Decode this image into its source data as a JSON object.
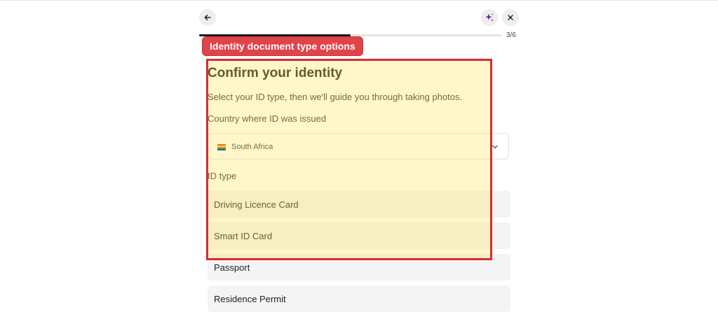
{
  "header": {
    "back_icon": "arrow-left-icon",
    "ai_icon": "sparkle-icon",
    "close_icon": "close-icon",
    "progress_text": "3/6",
    "progress_fraction": 0.5
  },
  "page": {
    "title": "Confirm your identity",
    "subtitle": "Select your ID type, then we'll guide you through taking photos.",
    "country_label": "Country where ID was issued",
    "country_value": "South Africa",
    "id_type_label": "ID type",
    "id_options": [
      "Driving Licence Card",
      "Smart ID Card",
      "Passport",
      "Residence Permit"
    ]
  },
  "annotation": {
    "label": "Identity document type options",
    "color": "#d42d35"
  },
  "colors": {
    "highlight_fill": "#ffe25a",
    "flag": [
      "#e03c31",
      "#ffb612",
      "#007749",
      "#001489"
    ]
  }
}
